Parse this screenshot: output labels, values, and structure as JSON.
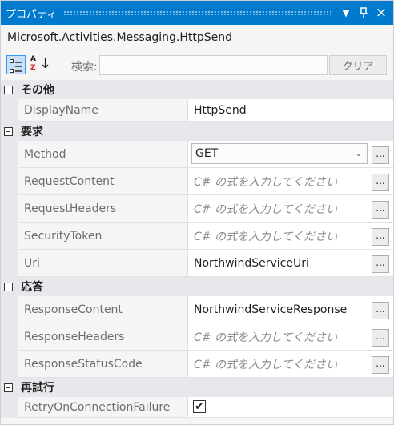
{
  "window": {
    "title": "プロパティ",
    "dropdown_icon": "▼",
    "pin_icon": "ᛕ",
    "close_icon": "×"
  },
  "object_type": "Microsoft.Activities.Messaging.HttpSend",
  "toolbar": {
    "categorized_icon": "categorized-view-icon",
    "alphabetical_icon": "alphabetical-sort-icon",
    "alpha_a": "A",
    "alpha_z": "Z",
    "alpha_arrow": "↓",
    "search_label": "検索:",
    "search_value": "",
    "clear_label": "クリア"
  },
  "ellipsis": "...",
  "placeholder": "C# の式を入力してください",
  "categories": [
    {
      "label": "その他",
      "properties": [
        {
          "name": "DisplayName",
          "value": "HttpSend",
          "type": "text"
        }
      ]
    },
    {
      "label": "要求",
      "properties": [
        {
          "name": "Method",
          "value": "GET",
          "type": "combo"
        },
        {
          "name": "RequestContent",
          "value": "C# の式を入力してください",
          "type": "placeholder"
        },
        {
          "name": "RequestHeaders",
          "value": "C# の式を入力してください",
          "type": "placeholder"
        },
        {
          "name": "SecurityToken",
          "value": "C# の式を入力してください",
          "type": "placeholder"
        },
        {
          "name": "Uri",
          "value": "NorthwindServiceUri",
          "type": "expr"
        }
      ]
    },
    {
      "label": "応答",
      "properties": [
        {
          "name": "ResponseContent",
          "value": "NorthwindServiceResponse",
          "type": "expr"
        },
        {
          "name": "ResponseHeaders",
          "value": "C# の式を入力してください",
          "type": "placeholder"
        },
        {
          "name": "ResponseStatusCode",
          "value": "C# の式を入力してください",
          "type": "placeholder"
        }
      ]
    },
    {
      "label": "再試行",
      "properties": [
        {
          "name": "RetryOnConnectionFailure",
          "value": "✔",
          "checked": true,
          "type": "checkbox"
        }
      ]
    }
  ],
  "colors": {
    "title_bar": "#007acc",
    "category_bg": "#e8e8ec",
    "value_bg": "#ffffff",
    "name_text": "#6d6d6d"
  }
}
